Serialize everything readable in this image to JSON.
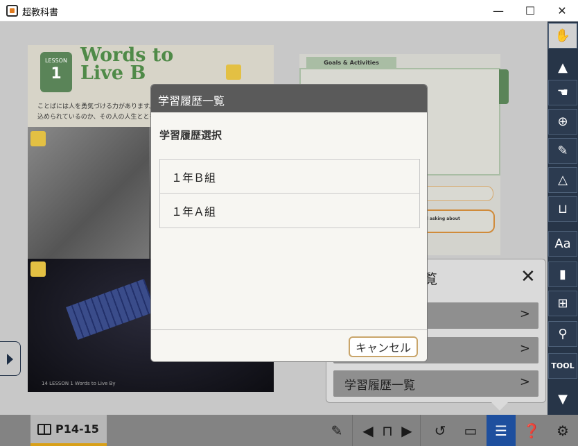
{
  "window": {
    "title": "超教科書",
    "minimize": "—",
    "maximize": "☐",
    "close": "✕"
  },
  "page_left": {
    "lesson_label": "LESSON",
    "lesson_number": "1",
    "title_line1": "Words to",
    "title_line2": "Live B",
    "jp_line1": "ことばには人を勇気づける力があります。次の",
    "jp_line2": "込められているのか、その人の人生とともに知",
    "footer": "14  LESSON 1  Words to Live By"
  },
  "page_right": {
    "goals_tab": "Goals & Activities",
    "box_text": "t, and asking about"
  },
  "menu_popup": {
    "title": "覧",
    "close": "✕",
    "items": [
      {
        "label": "",
        "chevron": ">"
      },
      {
        "label": "覧",
        "chevron": ">"
      },
      {
        "label": "学習履歴一覧",
        "chevron": ">"
      }
    ]
  },
  "toolbar": {
    "tool_label": "TOOL"
  },
  "bottombar": {
    "page_label": "P14-15"
  },
  "modal": {
    "header": "学習履歴一覧",
    "subtitle": "学習履歴選択",
    "rows": [
      "１年Ｂ組",
      "１年Ａ組"
    ],
    "cancel": "キャンセル"
  }
}
